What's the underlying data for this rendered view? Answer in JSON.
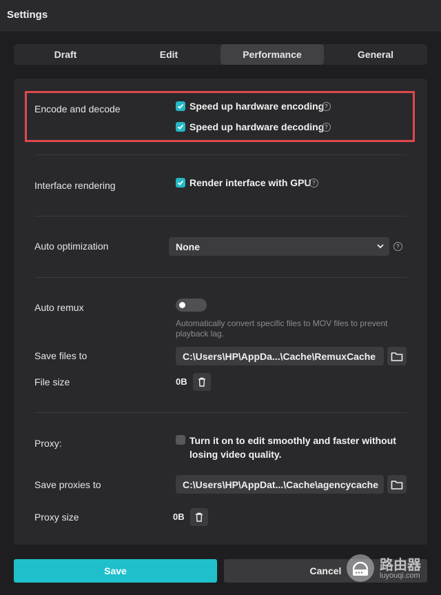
{
  "window": {
    "title": "Settings"
  },
  "tabs": [
    {
      "label": "Draft"
    },
    {
      "label": "Edit"
    },
    {
      "label": "Performance",
      "active": true
    },
    {
      "label": "General"
    }
  ],
  "encode": {
    "label": "Encode and decode",
    "options": [
      {
        "label": "Speed up hardware encoding",
        "checked": true
      },
      {
        "label": "Speed up hardware decoding",
        "checked": true
      }
    ]
  },
  "rendering": {
    "label": "Interface rendering",
    "option": {
      "label": "Render interface with GPU",
      "checked": true
    }
  },
  "optimization": {
    "label": "Auto optimization",
    "value": "None"
  },
  "remux": {
    "label": "Auto remux",
    "enabled": false,
    "hint": "Automatically convert specific files to MOV files to prevent playback lag.",
    "save_label": "Save files to",
    "save_path": "C:\\Users\\HP\\AppDa...\\Cache\\RemuxCache",
    "size_label": "File size",
    "size_value": "0B"
  },
  "proxy": {
    "label": "Proxy:",
    "option": {
      "label": "Turn it on to edit smoothly and faster without losing video quality.",
      "checked": false
    },
    "save_label": "Save proxies to",
    "save_path": "C:\\Users\\HP\\AppDat...\\Cache\\agencycache",
    "size_label": "Proxy size",
    "size_value": "0B"
  },
  "footer": {
    "save": "Save",
    "cancel": "Cancel"
  },
  "watermark": {
    "text": "路由器",
    "sub": "luyouqi.com"
  },
  "colors": {
    "accent": "#1fc0cc",
    "highlight": "#e0484d"
  }
}
